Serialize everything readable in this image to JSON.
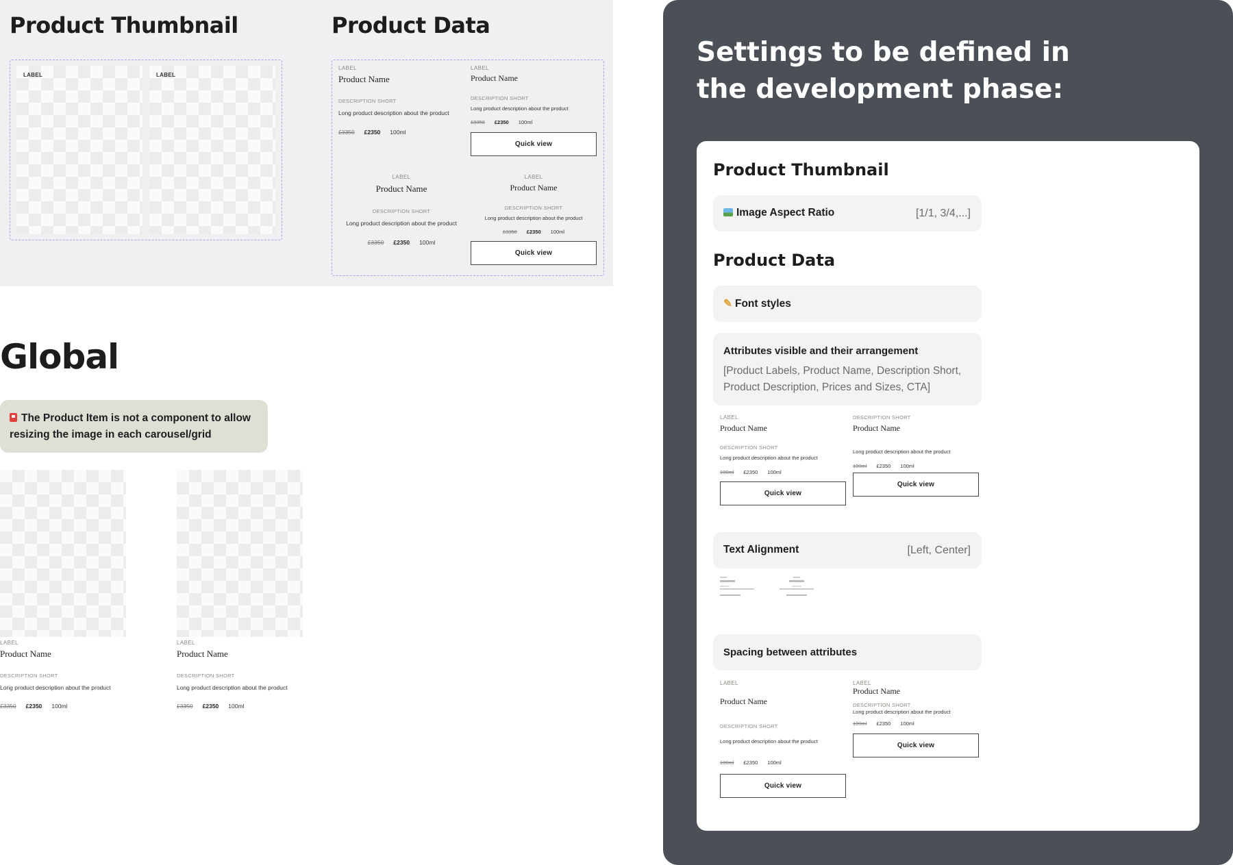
{
  "canvas": {
    "product_thumbnail_title": "Product Thumbnail",
    "product_data_title": "Product Data",
    "global_title": "Global",
    "thumbnail_label": "LABEL",
    "note": "The Product Item is not a component to allow resizing the image in each carousel/grid"
  },
  "card": {
    "label": "LABEL",
    "name": "Product Name",
    "desc_short": "DESCRIPTION SHORT",
    "desc_long": "Long product description about the product",
    "old_price": "£3350",
    "new_price": "£2350",
    "size": "100ml",
    "old_size": "100ml",
    "cta": "Quick view"
  },
  "panel": {
    "title": "Settings to be defined in the development phase:",
    "sections": {
      "thumbnail": "Product Thumbnail",
      "data": "Product Data"
    },
    "aspect_ratio": {
      "label": "Image Aspect Ratio",
      "value": "[1/1, 3/4,...]",
      "icon": "picture-icon"
    },
    "font_styles": {
      "label": "Font styles",
      "icon": "pencil-icon"
    },
    "attributes": {
      "label": "Attributes visible and their arrangement",
      "value": "[Product Labels, Product Name, Description Short, Product Description, Prices and Sizes, CTA]"
    },
    "text_alignment": {
      "label": "Text Alignment",
      "value": "[Left, Center]"
    },
    "spacing": {
      "label": "Spacing between attributes"
    }
  },
  "colors": {
    "dark_panel": "#4b4f56",
    "dashed_frame": "#b39df2",
    "note_bg": "#dfdfd6",
    "pill_bg": "#f4f3f1"
  }
}
